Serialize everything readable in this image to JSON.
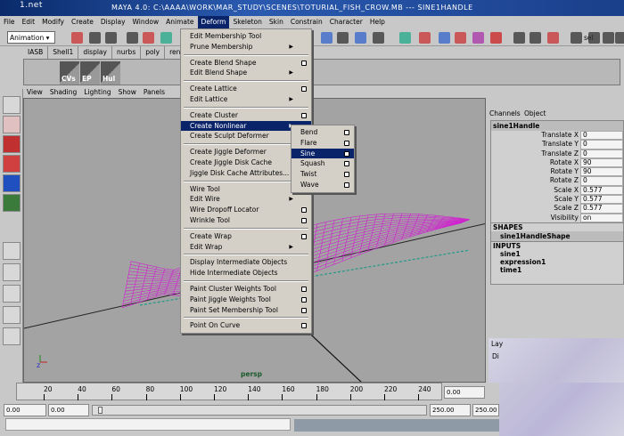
{
  "window": {
    "logo": "1.net",
    "title": "MAYA 4.0: C:\\AAAA\\WORK\\MAR_STUDY\\SCENES\\TOTURIAL_FISH_CROW.MB  ---  SINE1HANDLE"
  },
  "menubar": [
    "File",
    "Edit",
    "Modify",
    "Create",
    "Display",
    "Window",
    "Animate",
    "Deform",
    "Skeleton",
    "Skin",
    "Constrain",
    "Character",
    "Help"
  ],
  "active_menu": "Deform",
  "toolbar": {
    "mode": "Animation",
    "sel_label": "sel"
  },
  "shelf": {
    "tabs": [
      "IASB",
      "Shell1",
      "display",
      "nurbs",
      "poly",
      "renderm"
    ],
    "buttons": [
      "CVs",
      "EP",
      "Hul"
    ]
  },
  "panel_menu": [
    "View",
    "Shading",
    "Lighting",
    "Show",
    "Panels"
  ],
  "viewport": {
    "camera": "persp",
    "mesh_color": "#d020d0"
  },
  "deform_menu": [
    {
      "label": "Edit Membership Tool"
    },
    {
      "label": "Prune Membership",
      "submenu": true
    },
    {
      "sep": true
    },
    {
      "label": "Create Blend Shape",
      "option": true
    },
    {
      "label": "Edit Blend Shape",
      "submenu": true
    },
    {
      "sep": true
    },
    {
      "label": "Create Lattice",
      "option": true
    },
    {
      "label": "Edit Lattice",
      "submenu": true
    },
    {
      "sep": true
    },
    {
      "label": "Create Cluster",
      "option": true
    },
    {
      "label": "Create Nonlinear",
      "submenu": true,
      "highlighted": true
    },
    {
      "label": "Create Sculpt Deformer"
    },
    {
      "sep": true
    },
    {
      "label": "Create Jiggle Deformer"
    },
    {
      "label": "Create Jiggle Disk Cache"
    },
    {
      "label": "Jiggle Disk Cache Attributes..."
    },
    {
      "sep": true
    },
    {
      "label": "Wire Tool"
    },
    {
      "label": "Edit Wire",
      "submenu": true
    },
    {
      "label": "Wire Dropoff Locator",
      "option": true
    },
    {
      "label": "Wrinkle Tool",
      "option": true
    },
    {
      "sep": true
    },
    {
      "label": "Create Wrap",
      "option": true
    },
    {
      "label": "Edit Wrap",
      "submenu": true
    },
    {
      "sep": true
    },
    {
      "label": "Display Intermediate Objects"
    },
    {
      "label": "Hide Intermediate Objects"
    },
    {
      "sep": true
    },
    {
      "label": "Paint Cluster Weights Tool",
      "option": true
    },
    {
      "label": "Paint Jiggle Weights Tool",
      "option": true
    },
    {
      "label": "Paint Set Membership Tool",
      "option": true
    },
    {
      "sep": true
    },
    {
      "label": "Point On Curve",
      "option": true
    }
  ],
  "nonlinear_submenu": [
    {
      "label": "Bend",
      "option": true
    },
    {
      "label": "Flare",
      "option": true
    },
    {
      "label": "Sine",
      "option": true,
      "highlighted": true
    },
    {
      "label": "Squash",
      "option": true
    },
    {
      "label": "Twist",
      "option": true
    },
    {
      "label": "Wave",
      "option": true
    }
  ],
  "channel_box": {
    "tabs": "Channels",
    "tab2": "Object",
    "node": "sine1Handle",
    "attrs": [
      {
        "k": "Translate X",
        "v": "0"
      },
      {
        "k": "Translate Y",
        "v": "0"
      },
      {
        "k": "Translate Z",
        "v": "0"
      },
      {
        "k": "Rotate X",
        "v": "90"
      },
      {
        "k": "Rotate Y",
        "v": "90"
      },
      {
        "k": "Rotate Z",
        "v": "0"
      },
      {
        "k": "Scale X",
        "v": "0.577"
      },
      {
        "k": "Scale Y",
        "v": "0.577"
      },
      {
        "k": "Scale Z",
        "v": "0.577"
      },
      {
        "k": "Visibility",
        "v": "on"
      }
    ],
    "shapes_label": "SHAPES",
    "shape": "sine1HandleShape",
    "inputs_label": "INPUTS",
    "inputs": [
      "sine1",
      "expression1",
      "time1"
    ]
  },
  "layers": {
    "label": "Lay",
    "field": "Di"
  },
  "timeline": {
    "ticks": [
      "20",
      "40",
      "60",
      "80",
      "100",
      "120",
      "140",
      "160",
      "180",
      "200",
      "220",
      "240"
    ],
    "current": "0.00",
    "start": "0.00",
    "playback_start": "0.00",
    "playback_end": "250.00",
    "end": "250.00"
  }
}
